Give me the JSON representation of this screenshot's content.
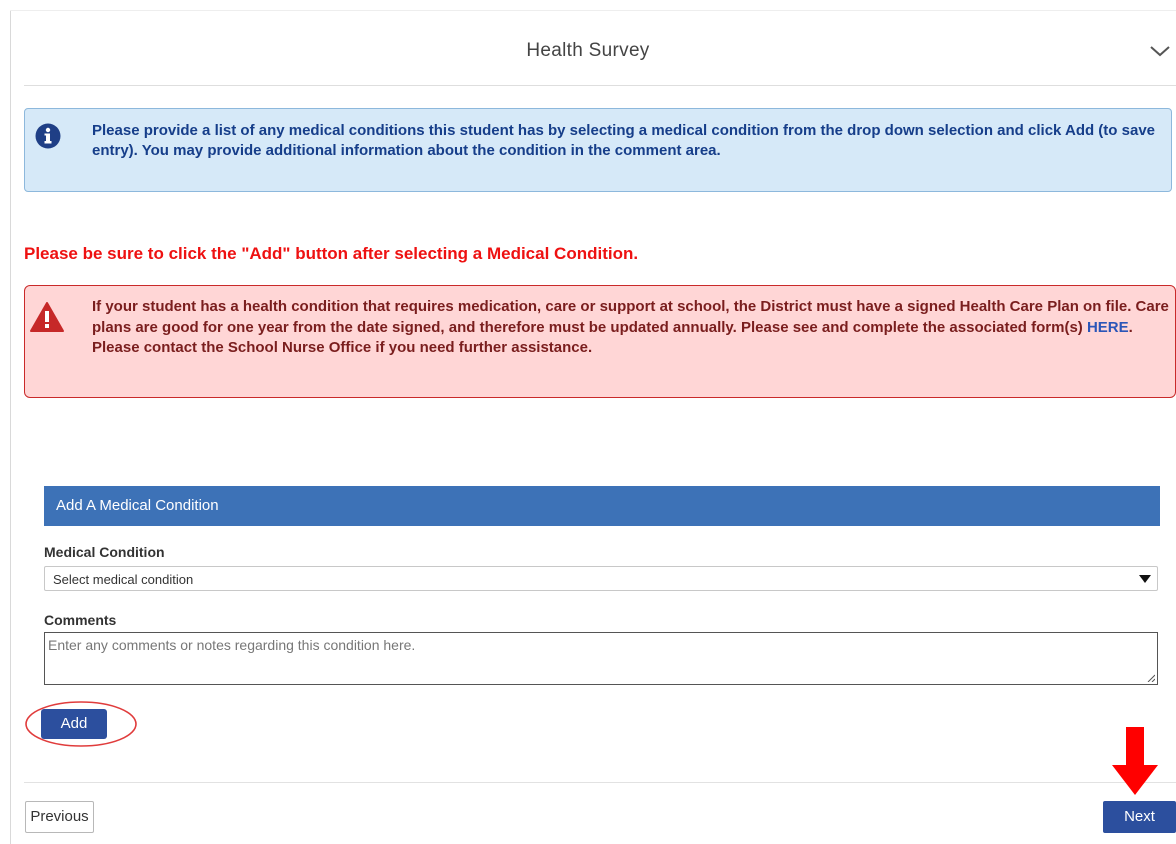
{
  "header": {
    "title": "Health Survey",
    "collapse_icon": "chevron-down-icon"
  },
  "info_box": {
    "icon": "info-circle-icon",
    "text": "Please provide a list of any medical conditions this student has by selecting a medical condition from the drop down selection and click Add (to save entry). You may provide additional information about the condition in the comment area.",
    "color": "#163e8a",
    "background": "#d6e9f8"
  },
  "warning_heading": "Please be sure to click the \"Add\" button after selecting a Medical Condition.",
  "alert_box": {
    "icon": "warning-triangle-icon",
    "text_before_link": "If your student has a health condition that requires medication, care or support at school, the District must have a signed Health Care Plan on file.  Care plans are good for one year from the date signed, and therefore must be updated annually.  Please see and complete the associated form(s) ",
    "link_text": "HERE",
    "text_after_link": ".  Please contact the School Nurse Office if you need further assistance.",
    "background": "#ffd6d6",
    "border_color": "#c92a2a"
  },
  "form": {
    "section_title": "Add A Medical Condition",
    "medical_condition_label": "Medical Condition",
    "medical_condition_value": "Select medical condition",
    "comments_label": "Comments",
    "comments_placeholder": "Enter any comments or notes regarding this condition here.",
    "add_label": "Add",
    "section_color": "#3d72b7"
  },
  "footer": {
    "previous_label": "Previous",
    "next_label": "Next",
    "button_color": "#2c4f9e"
  },
  "annotations": {
    "circle_color": "#e03c3c",
    "arrow_color": "#ff0000",
    "arrow_icon": "red-down-arrow-icon"
  }
}
